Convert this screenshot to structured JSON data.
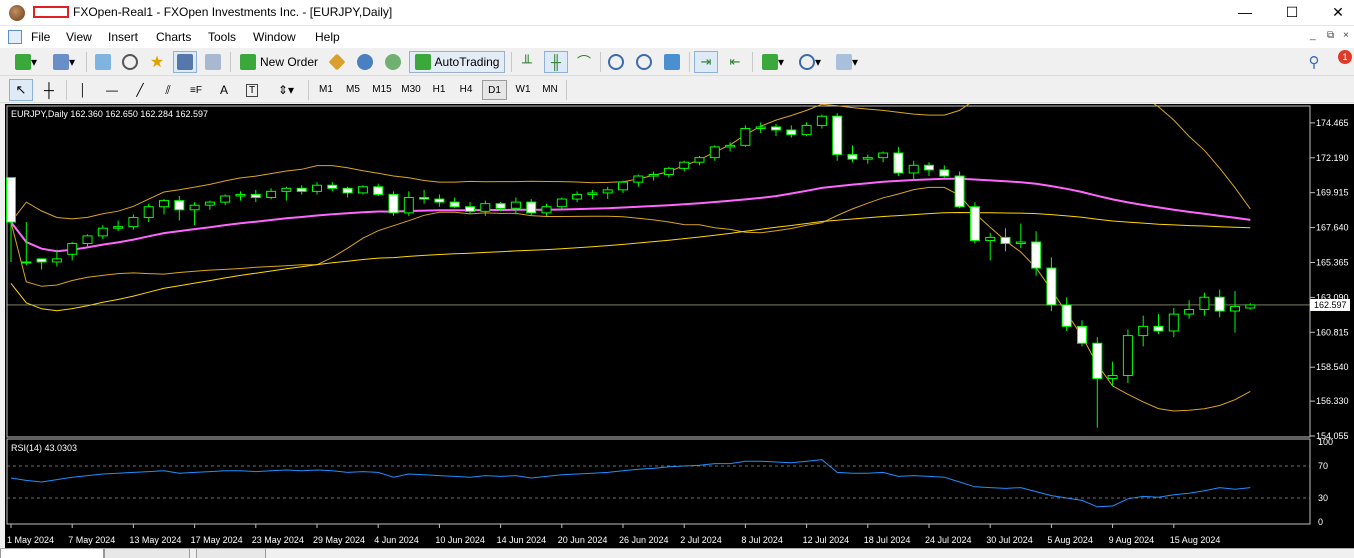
{
  "window": {
    "title": "FXOpen-Real1 - FXOpen Investments Inc. - [EURJPY,Daily]",
    "minimize": "—",
    "maximize": "☐",
    "close": "✕"
  },
  "menu": {
    "items": [
      "File",
      "View",
      "Insert",
      "Charts",
      "Tools",
      "Window",
      "Help"
    ],
    "mdi_minimize": "_",
    "mdi_restore": "⧉",
    "mdi_close": "×"
  },
  "toolbar": {
    "new_order": "New Order",
    "autotrading": "AutoTrading",
    "notification_count": "1"
  },
  "timeframes": [
    "M1",
    "M5",
    "M15",
    "M30",
    "H1",
    "H4",
    "D1",
    "W1",
    "MN"
  ],
  "active_timeframe": "D1",
  "chart": {
    "header": "EURJPY,Daily  162.360 162.650 162.284 162.597",
    "current_price": "162.597",
    "price_ticks": [
      "174.465",
      "172.190",
      "169.915",
      "167.640",
      "165.365",
      "163.090",
      "160.815",
      "158.540",
      "156.330",
      "154.055"
    ],
    "rsi_header": "RSI(14) 43.0303",
    "rsi_ticks": [
      "100",
      "70",
      "30",
      "0"
    ],
    "date_ticks": [
      "1 May 2024",
      "7 May 2024",
      "13 May 2024",
      "17 May 2024",
      "23 May 2024",
      "29 May 2024",
      "4 Jun 2024",
      "10 Jun 2024",
      "14 Jun 2024",
      "20 Jun 2024",
      "26 Jun 2024",
      "2 Jul 2024",
      "8 Jul 2024",
      "12 Jul 2024",
      "18 Jul 2024",
      "24 Jul 2024",
      "30 Jul 2024",
      "5 Aug 2024",
      "9 Aug 2024",
      "15 Aug 2024"
    ]
  },
  "colors": {
    "bull_candle": "#000000",
    "bear_candle": "#ffffff",
    "wick": "#00ff00",
    "bollinger": "#daa520",
    "ma_pink": "#ff66ff",
    "ma_yellow": "#ffd700",
    "rsi_line": "#1e90ff"
  },
  "chart_data": {
    "type": "candlestick",
    "title": "EURJPY,Daily",
    "y_range": [
      154.055,
      175.5
    ],
    "candles": [
      [
        170.9,
        168.2,
        165.4,
        168.0
      ],
      [
        165.4,
        168.0,
        165.2,
        165.4
      ],
      [
        165.6,
        165.6,
        164.9,
        165.4
      ],
      [
        165.4,
        166.2,
        165.1,
        165.6
      ],
      [
        165.9,
        166.7,
        165.5,
        166.6
      ],
      [
        166.6,
        167.2,
        166.4,
        167.1
      ],
      [
        167.1,
        167.8,
        166.9,
        167.6
      ],
      [
        167.6,
        168.1,
        167.4,
        167.7
      ],
      [
        167.7,
        168.5,
        167.5,
        168.3
      ],
      [
        168.3,
        169.2,
        168.0,
        169.0
      ],
      [
        169.0,
        169.5,
        168.5,
        169.4
      ],
      [
        169.4,
        169.7,
        168.1,
        168.8
      ],
      [
        168.8,
        169.3,
        167.8,
        169.1
      ],
      [
        169.1,
        169.4,
        168.8,
        169.3
      ],
      [
        169.3,
        169.8,
        169.1,
        169.7
      ],
      [
        169.7,
        170.0,
        169.4,
        169.8
      ],
      [
        169.8,
        170.1,
        169.3,
        169.6
      ],
      [
        169.6,
        170.2,
        169.5,
        170.0
      ],
      [
        170.0,
        170.3,
        169.4,
        170.2
      ],
      [
        170.2,
        170.4,
        169.8,
        170.0
      ],
      [
        170.0,
        170.6,
        169.8,
        170.4
      ],
      [
        170.4,
        170.6,
        170.0,
        170.2
      ],
      [
        170.2,
        170.3,
        169.6,
        169.9
      ],
      [
        169.9,
        170.4,
        169.8,
        170.3
      ],
      [
        170.3,
        170.5,
        169.7,
        169.8
      ],
      [
        169.8,
        170.0,
        168.4,
        168.6
      ],
      [
        168.6,
        170.0,
        168.4,
        169.6
      ],
      [
        169.6,
        170.1,
        169.2,
        169.5
      ],
      [
        169.5,
        169.8,
        169.0,
        169.3
      ],
      [
        169.3,
        169.6,
        168.9,
        169.0
      ],
      [
        169.0,
        169.3,
        168.5,
        168.7
      ],
      [
        168.7,
        169.4,
        168.4,
        169.2
      ],
      [
        169.2,
        169.3,
        168.7,
        168.9
      ],
      [
        168.9,
        169.6,
        168.5,
        169.3
      ],
      [
        169.3,
        169.5,
        168.4,
        168.6
      ],
      [
        168.6,
        169.2,
        168.4,
        169.0
      ],
      [
        169.0,
        169.6,
        168.8,
        169.5
      ],
      [
        169.5,
        170.0,
        169.3,
        169.8
      ],
      [
        169.8,
        170.1,
        169.5,
        169.9
      ],
      [
        169.9,
        170.3,
        169.5,
        170.1
      ],
      [
        170.1,
        170.7,
        169.9,
        170.6
      ],
      [
        170.6,
        171.1,
        170.3,
        171.0
      ],
      [
        171.0,
        171.3,
        170.7,
        171.1
      ],
      [
        171.1,
        171.6,
        170.9,
        171.5
      ],
      [
        171.5,
        172.0,
        171.3,
        171.9
      ],
      [
        171.9,
        172.3,
        171.7,
        172.2
      ],
      [
        172.2,
        173.0,
        172.0,
        172.9
      ],
      [
        172.9,
        173.2,
        172.6,
        173.0
      ],
      [
        173.0,
        174.3,
        172.9,
        174.1
      ],
      [
        174.1,
        174.5,
        173.8,
        174.2
      ],
      [
        174.2,
        174.4,
        173.6,
        174.0
      ],
      [
        174.0,
        174.3,
        173.5,
        173.7
      ],
      [
        173.7,
        174.5,
        173.6,
        174.3
      ],
      [
        174.3,
        175.0,
        174.1,
        174.9
      ],
      [
        174.9,
        175.1,
        172.0,
        172.4
      ],
      [
        172.4,
        173.0,
        171.9,
        172.1
      ],
      [
        172.1,
        172.4,
        171.8,
        172.2
      ],
      [
        172.2,
        172.6,
        171.9,
        172.5
      ],
      [
        172.5,
        172.9,
        171.0,
        171.2
      ],
      [
        171.2,
        172.0,
        170.7,
        171.7
      ],
      [
        171.7,
        171.9,
        171.0,
        171.4
      ],
      [
        171.4,
        171.7,
        170.9,
        171.0
      ],
      [
        171.0,
        171.3,
        168.9,
        169.0
      ],
      [
        169.0,
        169.3,
        166.6,
        166.8
      ],
      [
        166.8,
        167.3,
        165.5,
        167.0
      ],
      [
        167.0,
        167.6,
        166.1,
        166.6
      ],
      [
        166.6,
        167.9,
        166.3,
        166.7
      ],
      [
        166.7,
        167.4,
        164.5,
        165.0
      ],
      [
        165.0,
        165.7,
        162.2,
        162.6
      ],
      [
        162.6,
        163.1,
        160.9,
        161.2
      ],
      [
        161.2,
        161.6,
        159.9,
        160.1
      ],
      [
        160.1,
        160.5,
        154.6,
        157.8
      ],
      [
        157.8,
        158.9,
        157.3,
        158.0
      ],
      [
        158.0,
        161.0,
        157.5,
        160.6
      ],
      [
        160.6,
        161.9,
        159.9,
        161.2
      ],
      [
        161.2,
        162.0,
        160.7,
        160.9
      ],
      [
        160.9,
        162.4,
        160.5,
        162.0
      ],
      [
        162.0,
        162.9,
        161.7,
        162.3
      ],
      [
        162.3,
        163.4,
        161.9,
        163.1
      ],
      [
        163.1,
        163.6,
        161.8,
        162.2
      ],
      [
        162.2,
        163.5,
        160.8,
        162.5
      ],
      [
        162.4,
        162.7,
        162.3,
        162.6
      ]
    ],
    "rsi": [
      55,
      52,
      50,
      53,
      56,
      58,
      60,
      61,
      62,
      63,
      64,
      61,
      62,
      63,
      64,
      64,
      63,
      64,
      65,
      64,
      65,
      64,
      62,
      63,
      62,
      56,
      60,
      59,
      58,
      57,
      56,
      58,
      57,
      58,
      55,
      57,
      59,
      60,
      61,
      62,
      64,
      66,
      67,
      69,
      70,
      71,
      73,
      73,
      76,
      76,
      75,
      74,
      76,
      78,
      62,
      61,
      61,
      62,
      57,
      58,
      57,
      56,
      50,
      44,
      43,
      42,
      43,
      38,
      33,
      30,
      27,
      19,
      20,
      29,
      32,
      31,
      34,
      36,
      39,
      43,
      41,
      43
    ]
  }
}
